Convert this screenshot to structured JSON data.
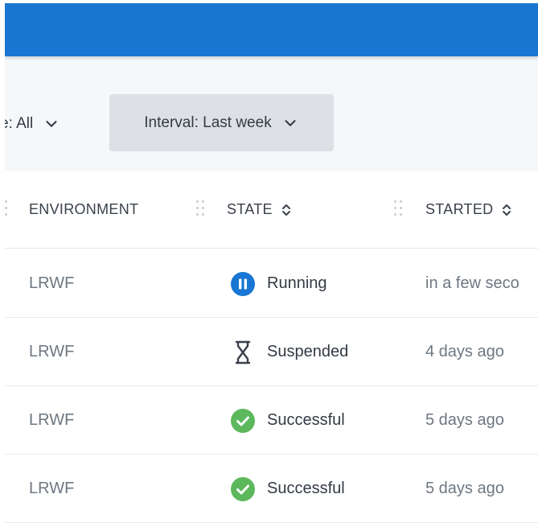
{
  "filters": {
    "type_label": "e: All",
    "interval_label": "Interval: Last week"
  },
  "columns": [
    {
      "label": "ENVIRONMENT",
      "sortable": false
    },
    {
      "label": "STATE",
      "sortable": true
    },
    {
      "label": "STARTED",
      "sortable": true
    }
  ],
  "rows": [
    {
      "environment": "LRWF",
      "state": "Running",
      "state_icon": "pause-circle-icon",
      "started": "in a few seco"
    },
    {
      "environment": "LRWF",
      "state": "Suspended",
      "state_icon": "hourglass-icon",
      "started": "4 days ago"
    },
    {
      "environment": "LRWF",
      "state": "Successful",
      "state_icon": "check-circle-icon",
      "started": "5 days ago"
    },
    {
      "environment": "LRWF",
      "state": "Successful",
      "state_icon": "check-circle-icon",
      "started": "5 days ago"
    }
  ],
  "colors": {
    "topbar": "#1976d2",
    "running": "#1976d2",
    "success": "#5cb85c",
    "toolbar_bg": "#f5f7fa"
  }
}
